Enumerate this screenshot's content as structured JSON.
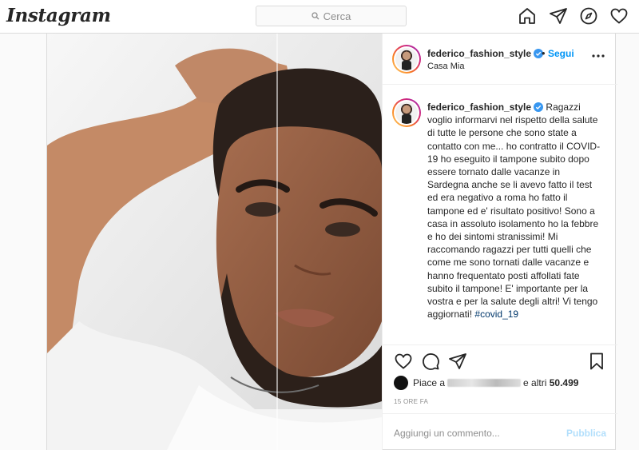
{
  "app": {
    "logo": "Instagram",
    "search_placeholder": "Cerca"
  },
  "nav": {
    "icons": [
      "home-icon",
      "direct-icon",
      "explore-icon",
      "activity-icon"
    ]
  },
  "post": {
    "username": "federico_fashion_style",
    "verified": true,
    "follow_label": "Segui",
    "separator": "•",
    "location": "Casa Mia",
    "caption_username": "federico_fashion_style",
    "caption_text": "Ragazzi voglio informarvi nel rispetto della salute di tutte le persone che sono state a contatto con me... ho contratto il COVID-19 ho eseguito il tampone subito dopo essere tornato dalle vacanze in Sardegna anche se li avevo fatto il test ed era negativo a roma ho fatto il tampone ed e' risultato positivo! Sono a casa in assoluto isolamento ho la febbre e ho dei sintomi stranissimi! Mi raccomando ragazzi per tutti quelli che come me sono tornati dalle vacanze e hanno frequentato posti affollati fate subito il tampone! E' importante per la vostra e per la salute degli altri! Vi tengo aggiornati!",
    "hashtag": "#covid_19",
    "caption_time": "15h",
    "likes_prefix": "Piace a",
    "likes_suffix": "e altri",
    "likes_count": "50.499",
    "time_ago": "15 ORE FA",
    "comment_placeholder": "Aggiungi un commento...",
    "publish_label": "Pubblica"
  },
  "colors": {
    "accent": "#0095f6",
    "publish_disabled": "#b2dffc",
    "border": "#dbdbdb"
  }
}
